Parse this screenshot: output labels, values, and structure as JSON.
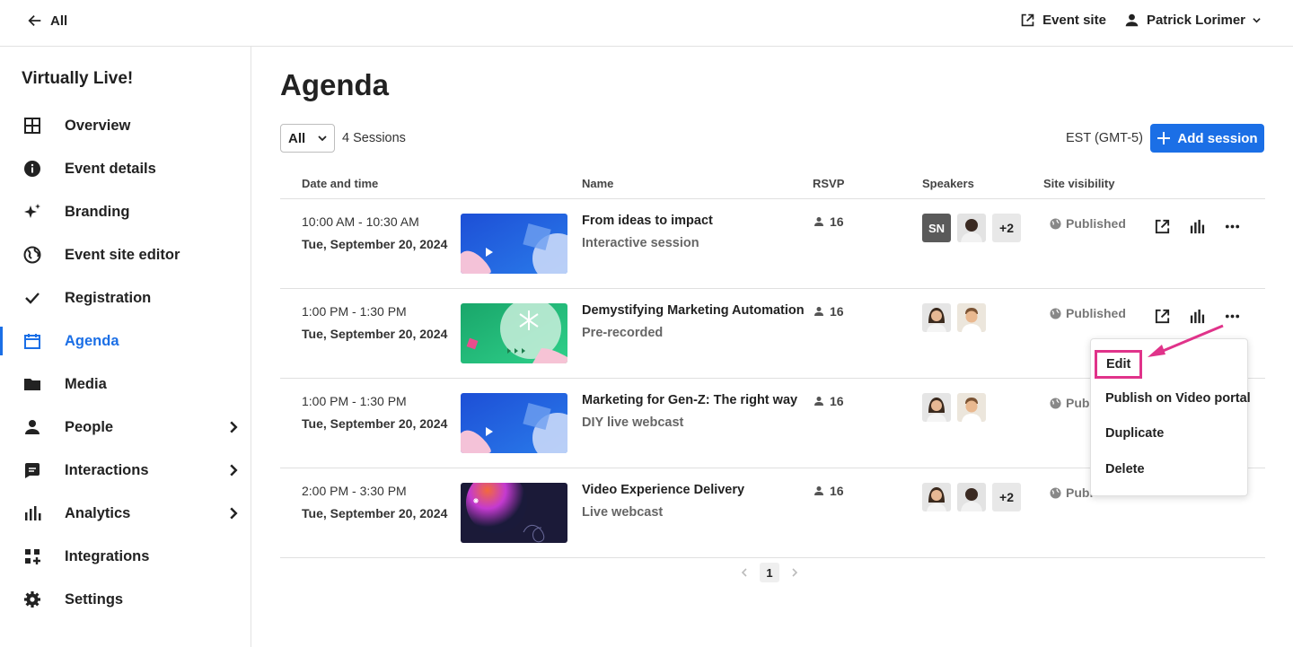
{
  "topbar": {
    "back_label": "All",
    "event_site_label": "Event site",
    "user_name": "Patrick Lorimer"
  },
  "sidebar": {
    "event_name": "Virtually Live!",
    "items": [
      {
        "label": "Overview",
        "icon": "grid-icon"
      },
      {
        "label": "Event details",
        "icon": "info-icon"
      },
      {
        "label": "Branding",
        "icon": "sparkle-icon"
      },
      {
        "label": "Event site editor",
        "icon": "globe-icon"
      },
      {
        "label": "Registration",
        "icon": "check-icon"
      },
      {
        "label": "Agenda",
        "icon": "calendar-icon",
        "active": true
      },
      {
        "label": "Media",
        "icon": "folder-icon"
      },
      {
        "label": "People",
        "icon": "person-icon",
        "expandable": true
      },
      {
        "label": "Interactions",
        "icon": "chat-icon",
        "expandable": true
      },
      {
        "label": "Analytics",
        "icon": "bar-chart-icon",
        "expandable": true
      },
      {
        "label": "Integrations",
        "icon": "apps-icon"
      },
      {
        "label": "Settings",
        "icon": "gear-icon"
      }
    ]
  },
  "main": {
    "title": "Agenda",
    "filter_value": "All",
    "sessions_count": "4 Sessions",
    "timezone": "EST (GMT-5)",
    "add_session_label": "Add session",
    "columns": {
      "date": "Date and time",
      "name": "Name",
      "rsvp": "RSVP",
      "speakers": "Speakers",
      "visibility": "Site visibility"
    },
    "sessions": [
      {
        "time": "10:00 AM - 10:30 AM",
        "date": "Tue, September 20, 2024",
        "name": "From ideas to impact",
        "type": "Interactive session",
        "rsvp": "16",
        "initials": "SN",
        "more": "+2",
        "visibility": "Published"
      },
      {
        "time": "1:00 PM - 1:30 PM",
        "date": "Tue, September 20, 2024",
        "name": "Demystifying Marketing Automation",
        "type": "Pre-recorded",
        "rsvp": "16",
        "initials": "",
        "more": "",
        "visibility": "Published"
      },
      {
        "time": "1:00 PM - 1:30 PM",
        "date": "Tue, September 20, 2024",
        "name": "Marketing for Gen-Z: The right way",
        "type": "DIY live webcast",
        "rsvp": "16",
        "initials": "",
        "more": "",
        "visibility": "Publ"
      },
      {
        "time": "2:00 PM - 3:30 PM",
        "date": "Tue, September 20, 2024",
        "name": "Video Experience Delivery",
        "type": "Live webcast",
        "rsvp": "16",
        "initials": "",
        "more": "+2",
        "visibility": "Publ"
      }
    ],
    "page": "1"
  },
  "menu": {
    "items": [
      "Edit",
      "Publish on Video portal",
      "Duplicate",
      "Delete"
    ]
  },
  "colors": {
    "accent": "#1b6fe6",
    "highlight": "#e0338a"
  }
}
